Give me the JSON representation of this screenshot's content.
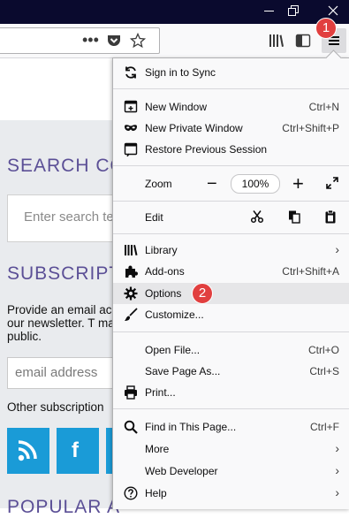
{
  "badges": {
    "first": "1",
    "second": "2"
  },
  "toolbar": {
    "overflow_dots": "•••"
  },
  "page": {
    "search_title": "SEARCH CO",
    "search_placeholder": "Enter search te",
    "subscriptions_title": "SUBSCRIPTIO",
    "subscription_text": "Provide an email ac to our newsletter. T made public.",
    "email_placeholder": "email address",
    "other_subscriptions": "Other subscription",
    "popular_title": "POPULAR A"
  },
  "menu": {
    "sync": "Sign in to Sync",
    "new_window": {
      "label": "New Window",
      "shortcut": "Ctrl+N"
    },
    "new_private": {
      "label": "New Private Window",
      "shortcut": "Ctrl+Shift+P"
    },
    "restore": {
      "label": "Restore Previous Session"
    },
    "zoom": {
      "label": "Zoom",
      "minus": "−",
      "value": "100%",
      "plus": "+"
    },
    "edit": {
      "label": "Edit"
    },
    "library": {
      "label": "Library"
    },
    "addons": {
      "label": "Add-ons",
      "shortcut": "Ctrl+Shift+A"
    },
    "options": {
      "label": "Options"
    },
    "customize": {
      "label": "Customize..."
    },
    "open_file": {
      "label": "Open File...",
      "shortcut": "Ctrl+O"
    },
    "save_page": {
      "label": "Save Page As...",
      "shortcut": "Ctrl+S"
    },
    "print": {
      "label": "Print..."
    },
    "find": {
      "label": "Find in This Page...",
      "shortcut": "Ctrl+F"
    },
    "more": {
      "label": "More"
    },
    "web_developer": {
      "label": "Web Developer"
    },
    "help": {
      "label": "Help"
    }
  },
  "colors": {
    "accent": "#e13f3f",
    "titlebar": "#0a0a2e",
    "social": "#1a9bd7",
    "heading": "#5b4f96"
  },
  "icons": [
    "minimize-icon",
    "restore-icon",
    "close-icon",
    "pocket-icon",
    "star-icon",
    "library-icon",
    "sidebar-icon",
    "hamburger-icon",
    "sync-icon",
    "new-window-icon",
    "private-mask-icon",
    "restore-session-icon",
    "fullscreen-icon",
    "cut-icon",
    "copy-icon",
    "paste-icon",
    "library-books-icon",
    "puzzle-icon",
    "gear-icon",
    "brush-icon",
    "printer-icon",
    "magnifier-icon",
    "help-icon",
    "rss-icon",
    "facebook-icon"
  ]
}
